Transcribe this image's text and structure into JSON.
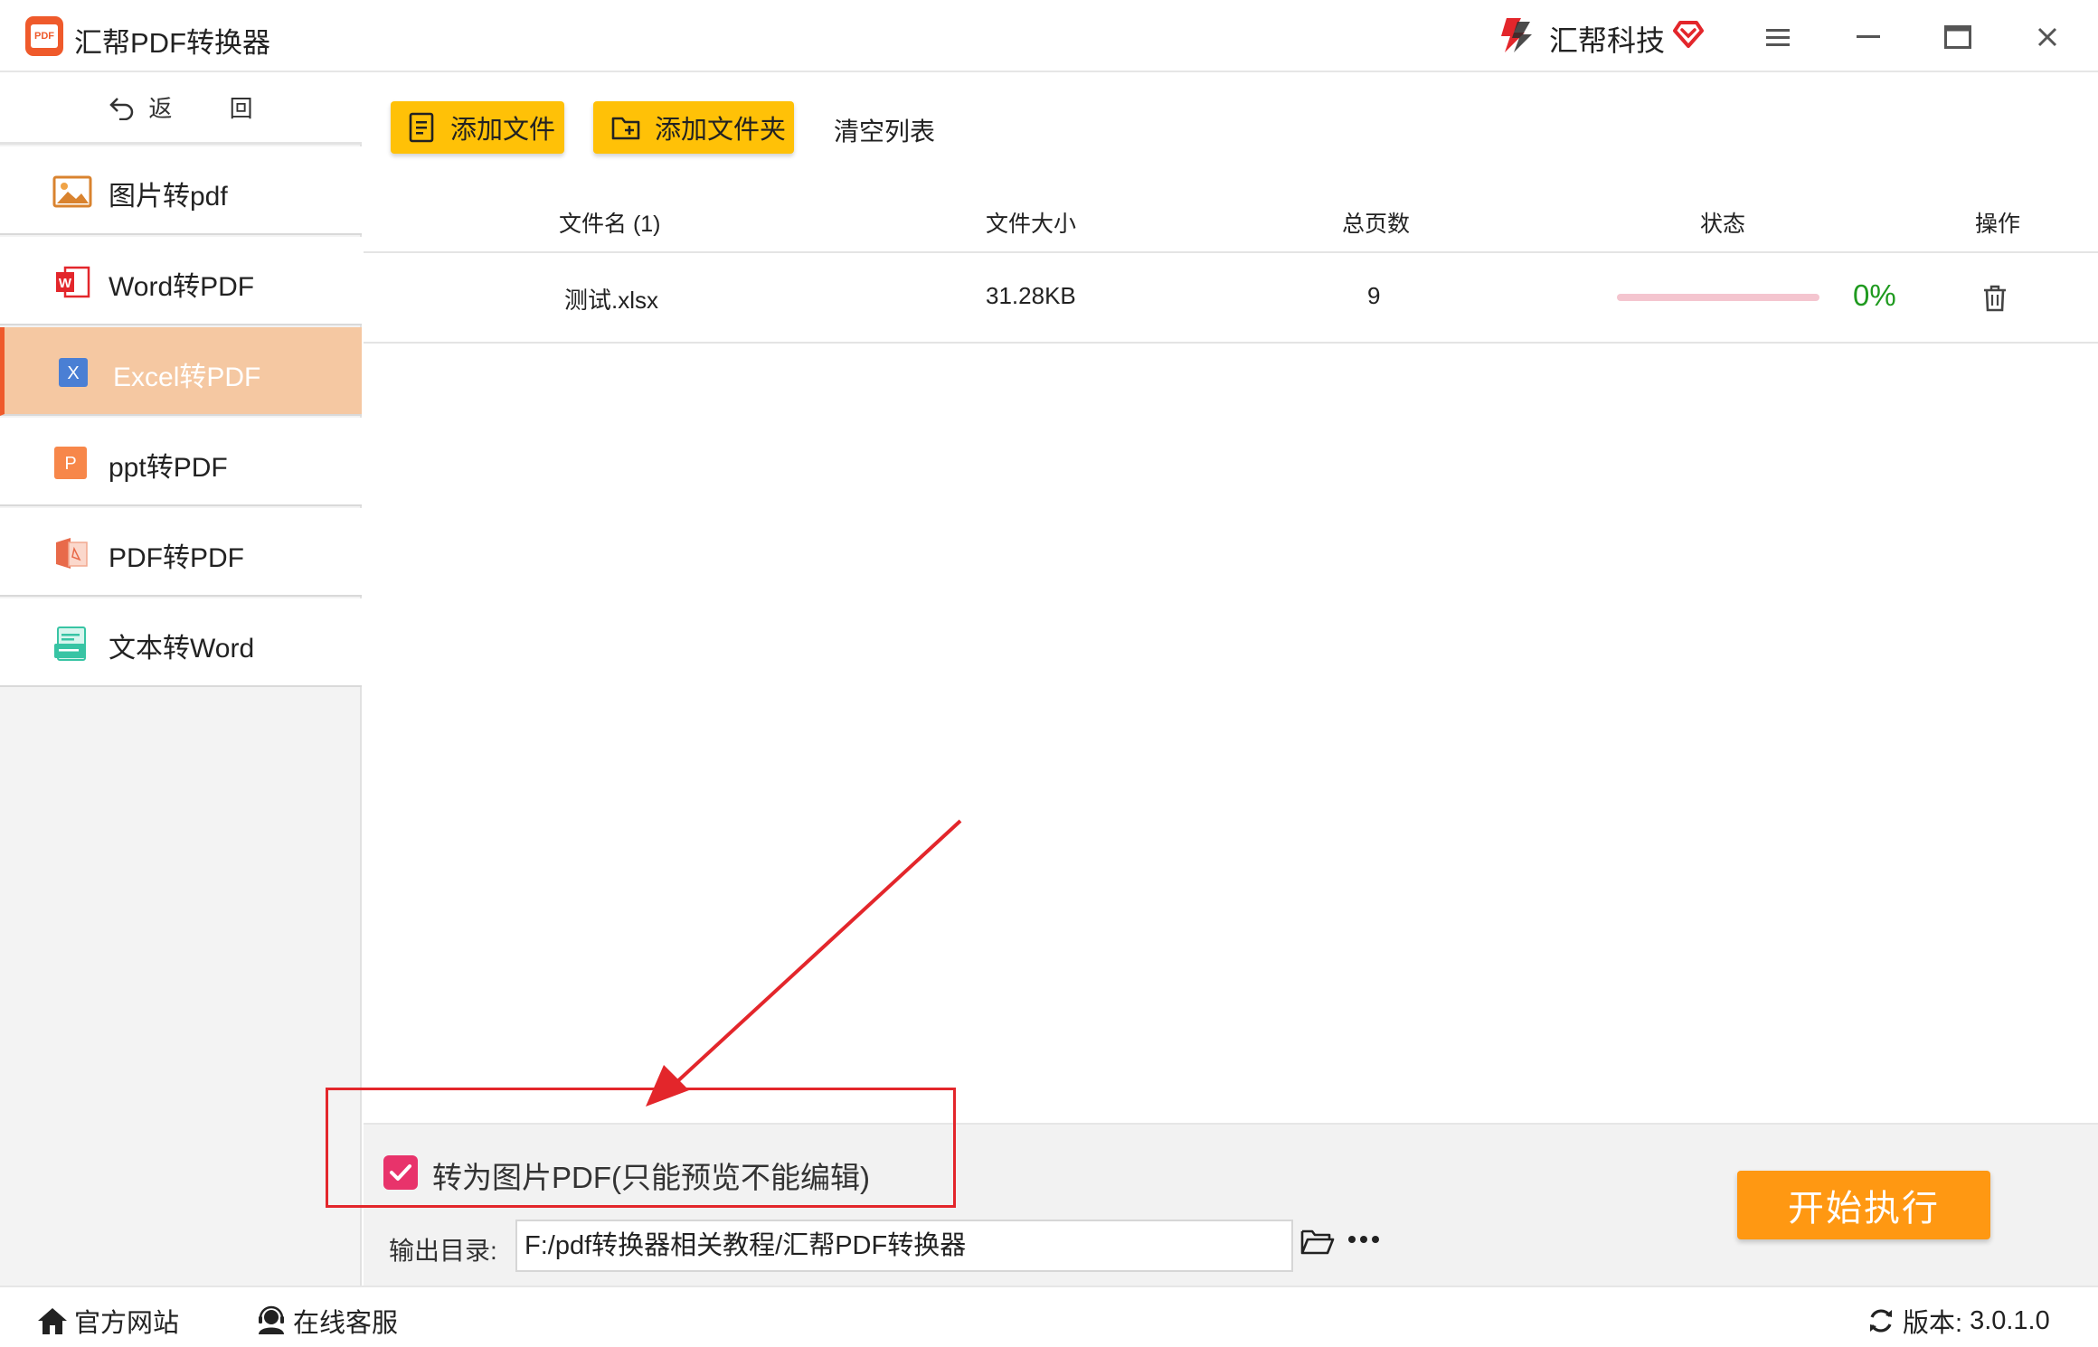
{
  "app": {
    "title": "汇帮PDF转换器",
    "brand_name": "汇帮科技"
  },
  "sidebar": {
    "back_label": "返 回",
    "items": [
      {
        "label": "图片转pdf",
        "icon": "image-icon"
      },
      {
        "label": "Word转PDF",
        "icon": "word-icon"
      },
      {
        "label": "Excel转PDF",
        "icon": "excel-icon",
        "active": true
      },
      {
        "label": "ppt转PDF",
        "icon": "ppt-icon"
      },
      {
        "label": "PDF转PDF",
        "icon": "pdf-icon"
      },
      {
        "label": "文本转Word",
        "icon": "text-icon"
      }
    ]
  },
  "toolbar": {
    "add_file": "添加文件",
    "add_folder": "添加文件夹",
    "clear_list": "清空列表"
  },
  "table": {
    "headers": {
      "name": "文件名 (1)",
      "size": "文件大小",
      "pages": "总页数",
      "status": "状态",
      "action": "操作"
    },
    "rows": [
      {
        "name": "测试.xlsx",
        "size": "31.28KB",
        "pages": "9",
        "progress_pct": "0%",
        "progress": 0
      }
    ]
  },
  "options": {
    "image_pdf_label": "转为图片PDF(只能预览不能编辑)",
    "image_pdf_checked": true,
    "output_label": "输出目录:",
    "output_path": "F:/pdf转换器相关教程/汇帮PDF转换器",
    "start_button": "开始执行"
  },
  "statusbar": {
    "website": "官方网站",
    "support": "在线客服",
    "version_label": "版本:",
    "version": "3.0.1.0"
  },
  "colors": {
    "accent_orange": "#ff9812",
    "button_yellow": "#ffc107",
    "active_nav": "#f5c8a2",
    "checkbox_pink": "#e8336b",
    "progress_green": "#1f9a1f",
    "annotation_red": "#e3262b"
  }
}
